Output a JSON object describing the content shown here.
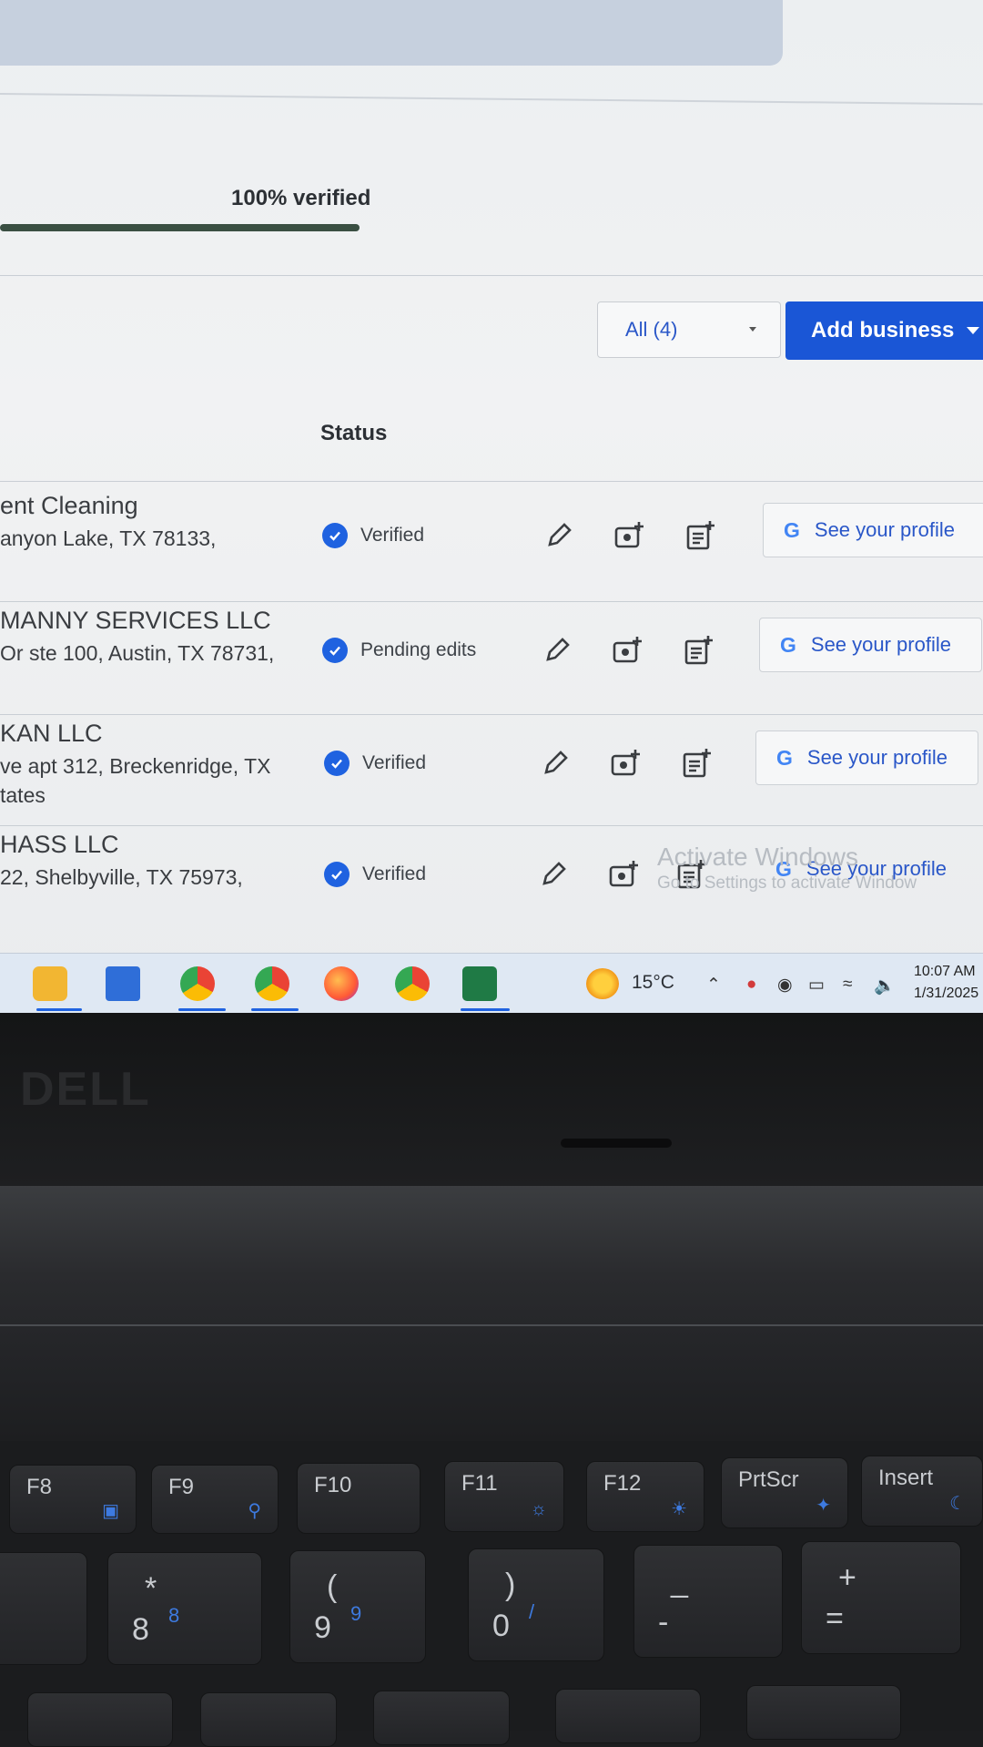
{
  "progress": {
    "label": "100% verified",
    "fraction": 1.0
  },
  "toolbar": {
    "filter_value": "All (4)",
    "add_business_label": "Add business"
  },
  "table": {
    "status_header": "Status",
    "rows": [
      {
        "name": "ent Cleaning",
        "address": "anyon Lake, TX 78133,",
        "address2": "",
        "status": "Verified",
        "profile_label": "See your profile"
      },
      {
        "name": "MANNY SERVICES LLC",
        "address": "Or ste 100, Austin, TX 78731,",
        "address2": "",
        "status": "Pending edits",
        "profile_label": "See your profile"
      },
      {
        "name": "KAN LLC",
        "address": "ve apt 312, Breckenridge, TX",
        "address2": "tates",
        "status": "Verified",
        "profile_label": "See your profile"
      },
      {
        "name": "HASS LLC",
        "address": "22, Shelbyville, TX 75973,",
        "address2": "",
        "status": "Verified",
        "profile_label": "See your profile"
      }
    ]
  },
  "watermark": {
    "title": "Activate Windows",
    "subtitle": "Go to Settings to activate Window"
  },
  "taskbar": {
    "apps": [
      "file-explorer-icon",
      "microsoft-store-icon",
      "chrome-profile-u-icon",
      "chrome-profile-g-icon",
      "firefox-icon",
      "chrome-icon",
      "excel-icon"
    ],
    "temperature": "15°C",
    "time": "10:07 AM",
    "date": "1/31/2025"
  },
  "laptop": {
    "brand": "DELL",
    "keys_row1": [
      {
        "label": "F8",
        "icon": "display-icon"
      },
      {
        "label": "F9",
        "icon": "search-icon"
      },
      {
        "label": "F10",
        "icon": ""
      },
      {
        "label": "F11",
        "icon": "brightness-down-icon"
      },
      {
        "label": "F12",
        "icon": "brightness-up-icon"
      },
      {
        "label": "PrtScr",
        "icon": "airplane-mode-icon"
      },
      {
        "label": "Insert",
        "icon": "sleep-icon"
      }
    ],
    "keys_row2": [
      {
        "top": "*",
        "main": "8",
        "sub": "8"
      },
      {
        "top": "(",
        "main": "9",
        "sub": "9"
      },
      {
        "top": ")",
        "main": "0",
        "sub": "/"
      },
      {
        "top": "_",
        "main": "-",
        "sub": ""
      },
      {
        "top": "+",
        "main": "=",
        "sub": ""
      }
    ]
  },
  "colors": {
    "accent": "#1a56d6",
    "verified_badge": "#1f62e0",
    "link": "#2a57c8"
  }
}
